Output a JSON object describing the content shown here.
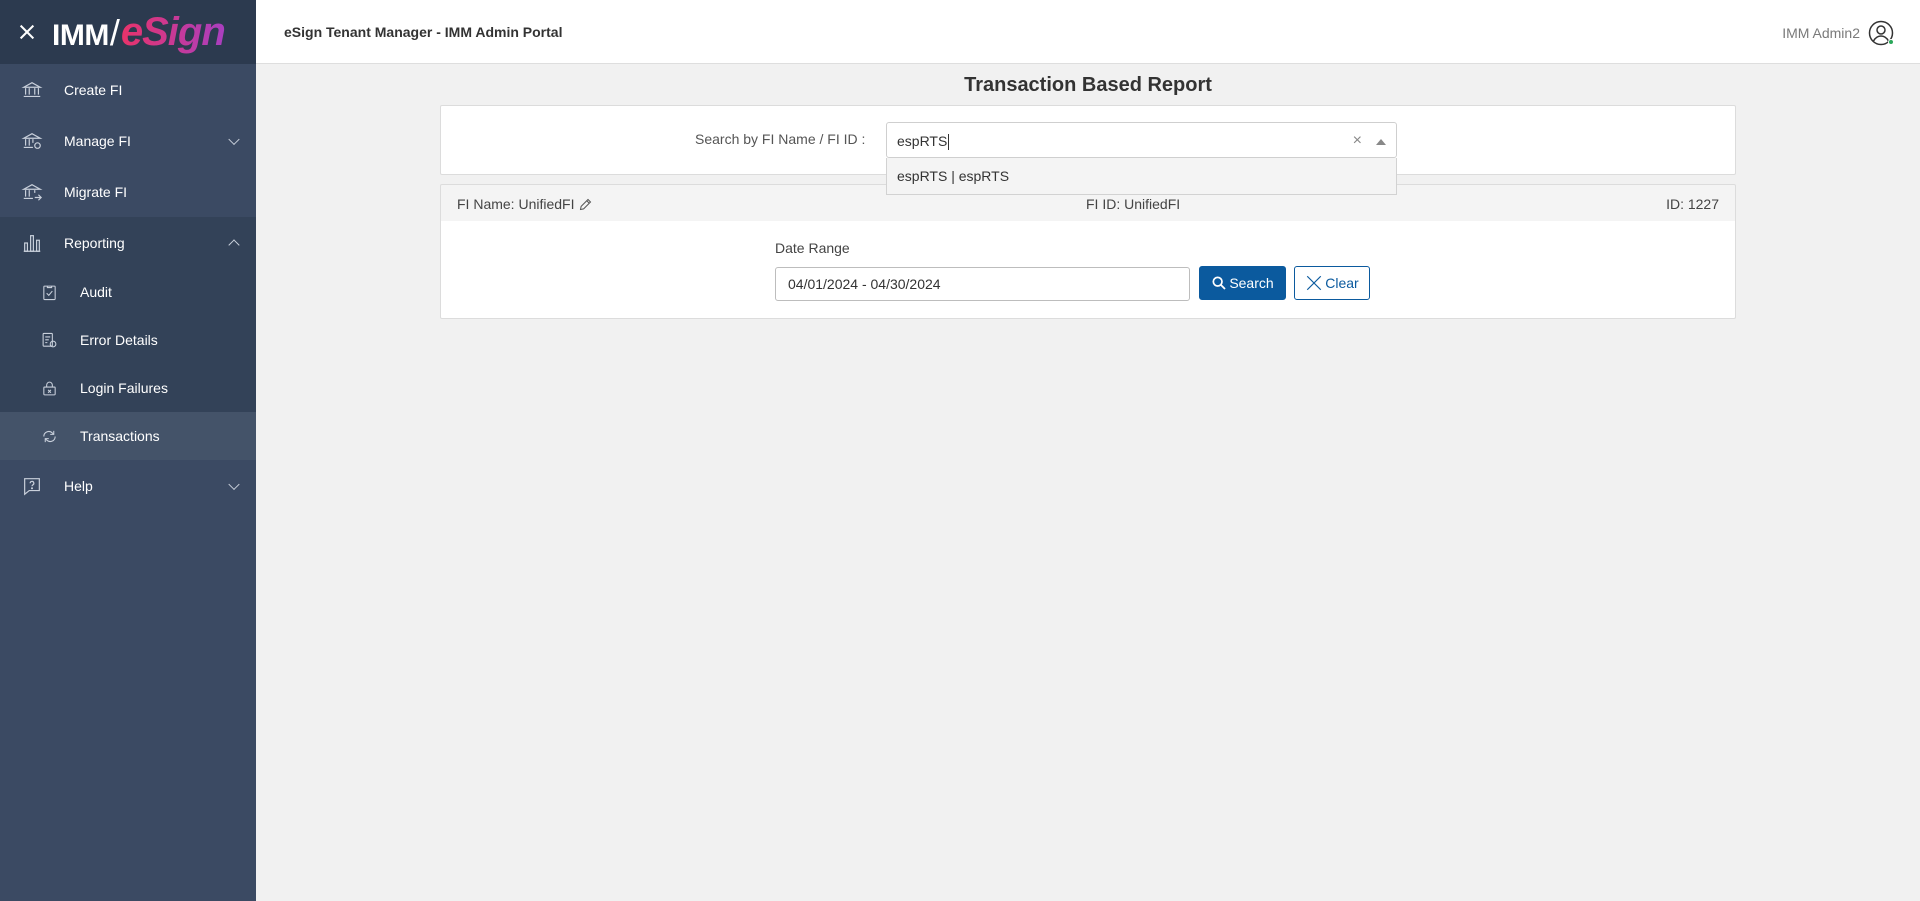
{
  "brand": {
    "logo_part1": "IMM",
    "logo_slash": "/",
    "logo_part2": "eSign"
  },
  "header": {
    "title": "eSign Tenant Manager - IMM Admin Portal",
    "user_name": "IMM Admin2"
  },
  "sidebar": {
    "items": [
      {
        "label": "Create FI",
        "icon": "bank-icon"
      },
      {
        "label": "Manage FI",
        "icon": "bank-gear-icon"
      },
      {
        "label": "Migrate FI",
        "icon": "bank-arrow-icon"
      },
      {
        "label": "Reporting",
        "icon": "bar-chart-icon"
      },
      {
        "label": "Help",
        "icon": "question-icon"
      }
    ],
    "reporting_sub": [
      {
        "label": "Audit",
        "icon": "clipboard-check-icon"
      },
      {
        "label": "Error Details",
        "icon": "document-gear-icon"
      },
      {
        "label": "Login Failures",
        "icon": "lock-icon"
      },
      {
        "label": "Transactions",
        "icon": "sync-icon"
      }
    ]
  },
  "main": {
    "page_title": "Transaction Based Report",
    "search_label": "Search by FI Name / FI ID :",
    "search_value": "espRTS",
    "dropdown_option": "espRTS | espRTS",
    "fi_name": "FI Name: UnifiedFI",
    "fi_id": "FI ID: UnifiedFI",
    "record_id": "ID: 1227",
    "date_range_label": "Date Range",
    "date_range_value": "04/01/2024 - 04/30/2024",
    "search_button": "Search",
    "clear_button": "Clear"
  }
}
